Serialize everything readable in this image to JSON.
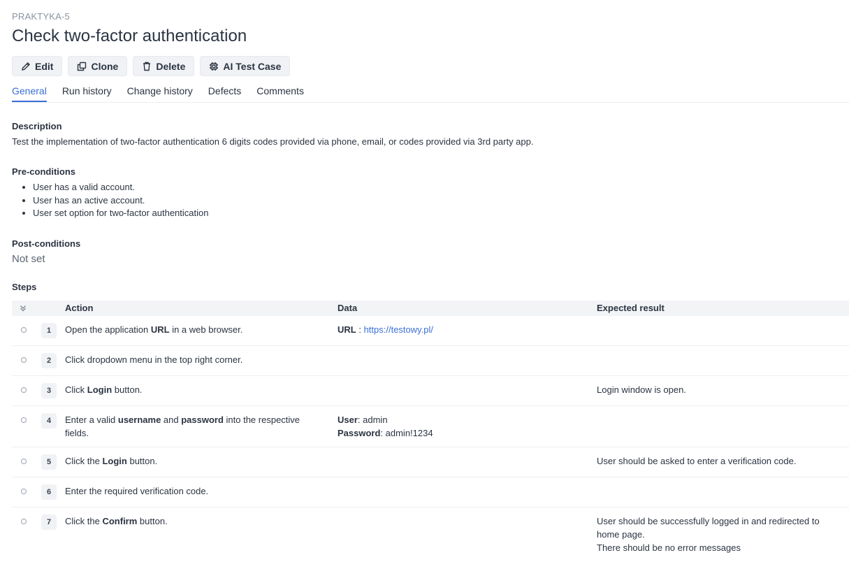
{
  "case": {
    "key": "PRAKTYKA-5",
    "title": "Check two-factor authentication"
  },
  "toolbar": {
    "edit": "Edit",
    "clone": "Clone",
    "delete": "Delete",
    "ai": "AI Test Case"
  },
  "tabs": [
    "General",
    "Run history",
    "Change history",
    "Defects",
    "Comments"
  ],
  "description": {
    "label": "Description",
    "text": "Test the implementation of two-factor authentication 6 digits codes provided via phone, email, or codes provided via 3rd party app."
  },
  "preconditions": {
    "label": "Pre-conditions",
    "items": [
      "User has a valid account.",
      "User has an active account.",
      "User set option for two-factor authentication"
    ]
  },
  "postconditions": {
    "label": "Post-conditions",
    "value": "Not set"
  },
  "steps": {
    "label": "Steps",
    "headers": {
      "action": "Action",
      "data": "Data",
      "expected": "Expected result"
    },
    "rows": [
      {
        "num": "1",
        "action": {
          "a": "Open the application ",
          "b": "URL",
          "c": " in a web browser."
        },
        "data": {
          "k1": "URL",
          "v1": " : ",
          "link": "https://testowy.pl/"
        },
        "expected": ""
      },
      {
        "num": "2",
        "action": {
          "text": "Click dropdown menu in the top right corner."
        },
        "expected": ""
      },
      {
        "num": "3",
        "action": {
          "a": "Click ",
          "b": "Login",
          "c": " button."
        },
        "expected": "Login window is open."
      },
      {
        "num": "4",
        "action": {
          "a": "Enter a valid ",
          "b": "username",
          "c": " and ",
          "d": "password",
          "e": " into the respective fields."
        },
        "data": {
          "k1": "User",
          "v1": ": admin",
          "k2": "Password",
          "v2": ": admin!1234"
        },
        "expected": ""
      },
      {
        "num": "5",
        "action": {
          "a": "Click the ",
          "b": "Login",
          "c": " button."
        },
        "expected": "User should be asked to enter a verification code."
      },
      {
        "num": "6",
        "action": {
          "text": "Enter the required verification code."
        },
        "expected": ""
      },
      {
        "num": "7",
        "action": {
          "a": "Click the ",
          "b": "Confirm",
          "c": " button."
        },
        "expected_lines": [
          "User should be successfully logged in and redirected to home page.",
          "There should be no error messages"
        ]
      }
    ]
  }
}
